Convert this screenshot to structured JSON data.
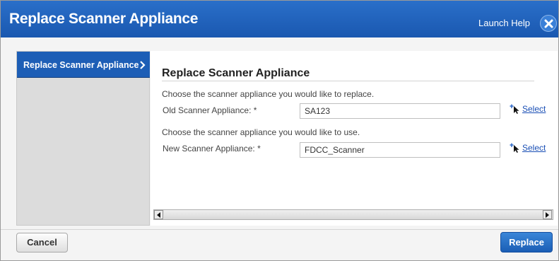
{
  "dialog": {
    "title": "Replace Scanner Appliance",
    "help_label": "Launch Help",
    "close_icon": "close-icon"
  },
  "sidebar": {
    "items": [
      {
        "label": "Replace Scanner Appliance",
        "icon": "chevron-right-icon",
        "active": true
      }
    ]
  },
  "main": {
    "section_title": "Replace Scanner Appliance",
    "old": {
      "instruction": "Choose the scanner appliance you would like to replace.",
      "label": "Old Scanner Appliance: *",
      "value": "SA123",
      "select_label": "Select"
    },
    "new": {
      "instruction": "Choose the scanner appliance you would like to use.",
      "label": "New Scanner Appliance: *",
      "value": "FDCC_Scanner",
      "select_label": "Select"
    }
  },
  "footer": {
    "cancel_label": "Cancel",
    "replace_label": "Replace"
  },
  "colors": {
    "titlebar": "#1d5eb6",
    "link": "#1a4fb5",
    "primary_button": "#2a70c8"
  }
}
